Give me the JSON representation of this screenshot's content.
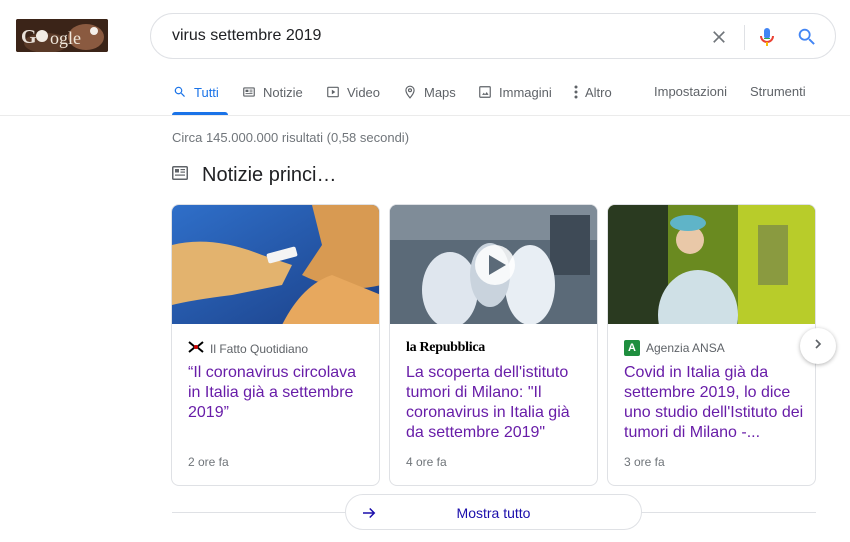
{
  "search": {
    "query": "virus settembre 2019"
  },
  "tabs": [
    {
      "label": "Tutti",
      "icon": "search-icon"
    },
    {
      "label": "Notizie",
      "icon": "news-icon"
    },
    {
      "label": "Video",
      "icon": "video-icon"
    },
    {
      "label": "Maps",
      "icon": "map-pin-icon"
    },
    {
      "label": "Immagini",
      "icon": "image-icon"
    },
    {
      "label": "Altro",
      "icon": "more-vert-icon"
    },
    {
      "label": "Impostazioni"
    },
    {
      "label": "Strumenti"
    }
  ],
  "results": {
    "stats": "Circa 145.000.000 risultati (0,58 secondi)"
  },
  "top_stories": {
    "title": "Notizie princi…",
    "cards": [
      {
        "source": "Il Fatto Quotidiano",
        "headline": "“Il coronavirus circolava in Italia già a settembre 2019”",
        "time": "2 ore fa"
      },
      {
        "source": "la Repubblica",
        "headline": "La scoperta dell'istituto tumori di Milano: \"Il coronavirus in Italia già da settembre 2019\"",
        "time": "4 ore fa"
      },
      {
        "source": "Agenzia ANSA",
        "source_logo": "A",
        "headline": "Covid in Italia già da settembre 2019, lo dice uno studio dell'Istituto dei tumori di Milano -...",
        "time": "3 ore fa"
      }
    ],
    "show_all": "Mostra tutto"
  },
  "colors": {
    "accent": "#1a73e8",
    "visited_link": "#681da8",
    "link": "#1a0dab"
  }
}
